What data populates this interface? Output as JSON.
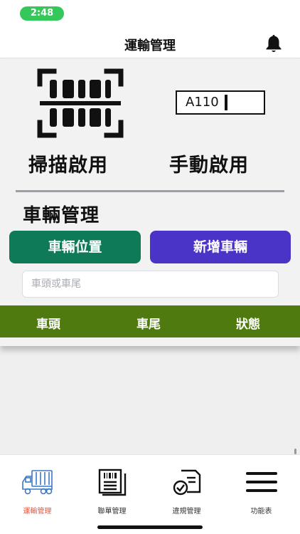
{
  "status_bar": {
    "time": "2:48"
  },
  "header": {
    "title": "運輸管理"
  },
  "scan": {
    "scan_label": "掃描啟用",
    "manual_label": "手動啟用",
    "plate_example": "A110"
  },
  "vehicle": {
    "section_title": "車輛管理",
    "location_button": "車輛位置",
    "add_button": "新增車輛",
    "search_placeholder": "車頭或車尾",
    "search_value": ""
  },
  "table": {
    "columns": [
      "車頭",
      "車尾",
      "狀態"
    ]
  },
  "tab_bar": {
    "tabs": [
      {
        "label": "運輸管理",
        "icon": "truck-icon",
        "active": true
      },
      {
        "label": "聯單管理",
        "icon": "document-barcode-icon",
        "active": false
      },
      {
        "label": "違規管理",
        "icon": "violation-document-icon",
        "active": false
      },
      {
        "label": "功能表",
        "icon": "menu-icon",
        "active": false
      }
    ]
  },
  "colors": {
    "time_pill": "#34c759",
    "location_button": "#0f7a58",
    "add_button": "#4a34c8",
    "table_header": "#4f7a0f",
    "active_tab": "#e8553a"
  }
}
